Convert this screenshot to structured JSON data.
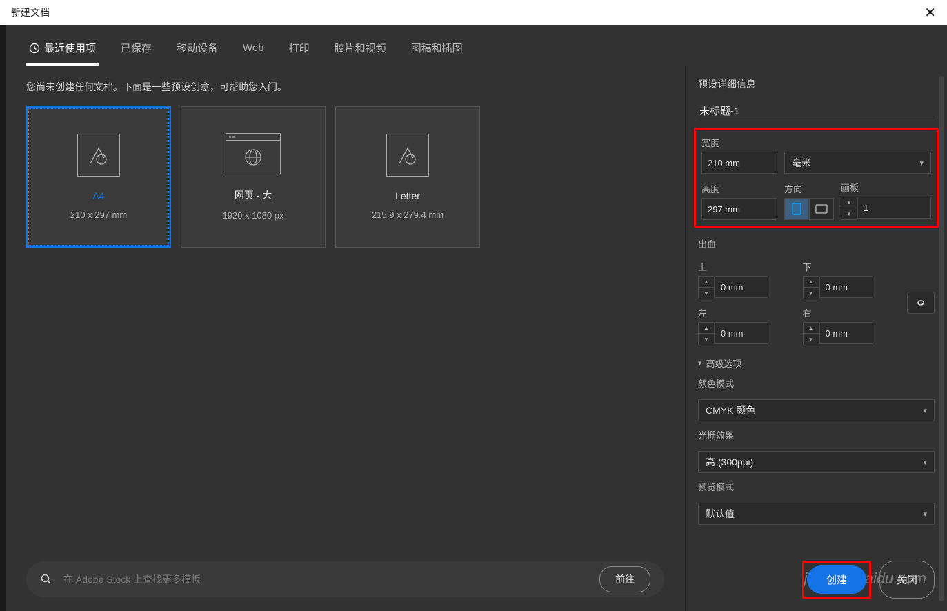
{
  "window": {
    "title": "新建文档"
  },
  "tabs": [
    {
      "label": "最近使用项",
      "active": true,
      "icon": "clock"
    },
    {
      "label": "已保存"
    },
    {
      "label": "移动设备"
    },
    {
      "label": "Web"
    },
    {
      "label": "打印"
    },
    {
      "label": "胶片和视频"
    },
    {
      "label": "图稿和插图"
    }
  ],
  "hint": "您尚未创建任何文档。下面是一些预设创意，可帮助您入门。",
  "presets": [
    {
      "name": "A4",
      "size": "210 x 297 mm",
      "selected": true,
      "icon": "doc-shapes"
    },
    {
      "name": "网页 - 大",
      "size": "1920 x 1080 px",
      "icon": "browser-globe"
    },
    {
      "name": "Letter",
      "size": "215.9 x 279.4 mm",
      "icon": "doc-shapes"
    }
  ],
  "search": {
    "placeholder": "在 Adobe Stock 上查找更多模板",
    "go": "前往"
  },
  "details": {
    "heading": "预设详细信息",
    "doc_name": "未标题-1",
    "width_label": "宽度",
    "width_value": "210 mm",
    "units_label": "毫米",
    "height_label": "高度",
    "height_value": "297 mm",
    "orient_label": "方向",
    "artboard_label": "画板",
    "artboard_value": "1",
    "bleed_label": "出血",
    "top_label": "上",
    "top_value": "0 mm",
    "bottom_label": "下",
    "bottom_value": "0 mm",
    "left_label": "左",
    "left_value": "0 mm",
    "right_label": "右",
    "right_value": "0 mm",
    "advanced_label": "高级选项",
    "color_mode_label": "颜色模式",
    "color_mode_value": "CMYK 颜色",
    "raster_label": "光栅效果",
    "raster_value": "高 (300ppi)",
    "preview_label": "预览模式",
    "preview_value": "默认值"
  },
  "buttons": {
    "create": "创建",
    "close": "关闭"
  },
  "watermark": "jingyan.baidu.com"
}
